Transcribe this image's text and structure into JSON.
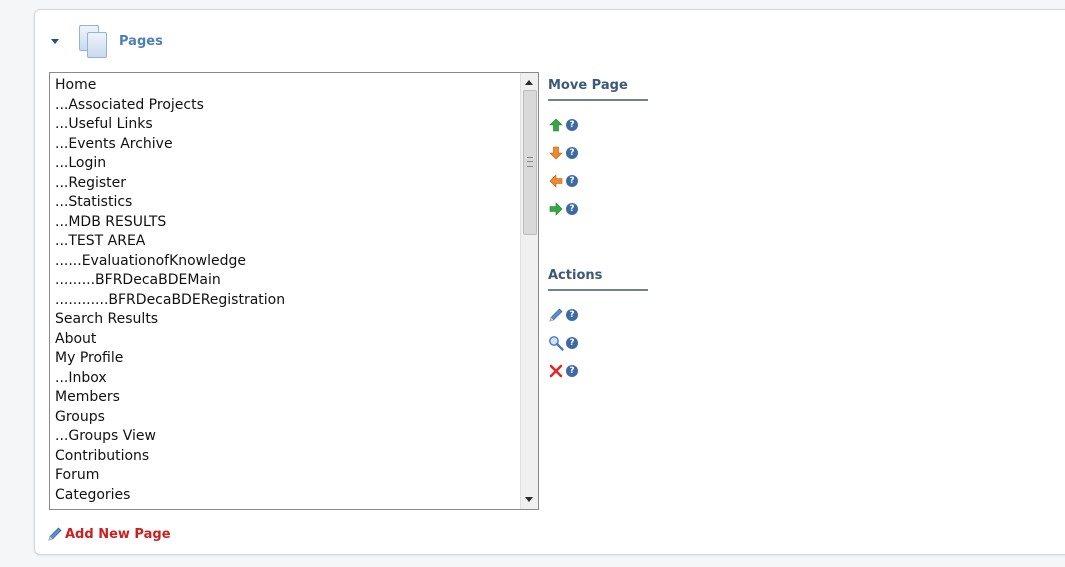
{
  "header": {
    "title": "Pages"
  },
  "pages": [
    "Home",
    "...Associated Projects",
    "...Useful Links",
    "...Events Archive",
    "...Login",
    "...Register",
    "...Statistics",
    "...MDB RESULTS",
    "...TEST AREA",
    "......EvaluationofKnowledge",
    ".........BFRDecaBDEMain",
    "............BFRDecaBDERegistration",
    "Search Results",
    "About",
    "My Profile",
    "...Inbox",
    "Members",
    "Groups",
    "...Groups View",
    "Contributions",
    "Forum",
    "Categories"
  ],
  "move_page": {
    "title": "Move Page",
    "icons": [
      "arrow-up-icon",
      "arrow-down-icon",
      "arrow-left-icon",
      "arrow-right-icon"
    ]
  },
  "actions": {
    "title": "Actions",
    "icons": [
      "pencil-edit-icon",
      "magnifier-view-icon",
      "delete-x-icon"
    ]
  },
  "add_page": {
    "label": "Add New Page"
  },
  "help_glyph": "?",
  "colors": {
    "header_title": "#4e7fb6",
    "section_title": "#3c5a78",
    "add_link": "#cc1f1f",
    "arrow_green": "#35a845",
    "arrow_orange": "#ee8a2a",
    "delete_red": "#e02a2a"
  }
}
